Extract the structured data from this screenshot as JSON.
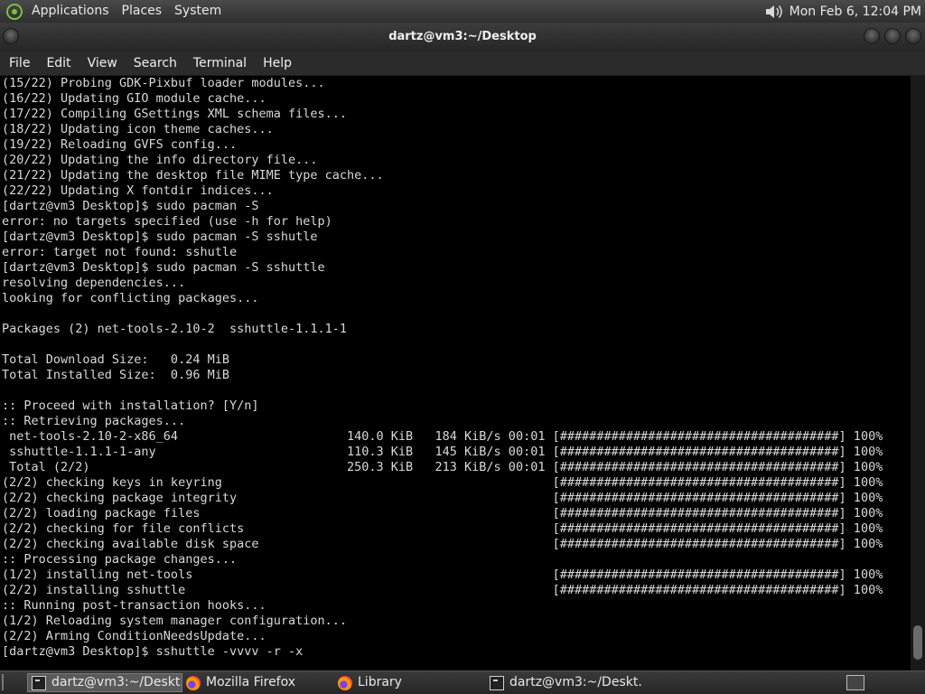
{
  "top_panel": {
    "menus": [
      "Applications",
      "Places",
      "System"
    ],
    "clock": "Mon Feb  6, 12:04 PM"
  },
  "window": {
    "title": "dartz@vm3:~/Desktop",
    "menus": [
      "File",
      "Edit",
      "View",
      "Search",
      "Terminal",
      "Help"
    ]
  },
  "terminal": {
    "lines": [
      "(15/22) Probing GDK-Pixbuf loader modules...",
      "(16/22) Updating GIO module cache...",
      "(17/22) Compiling GSettings XML schema files...",
      "(18/22) Updating icon theme caches...",
      "(19/22) Reloading GVFS config...",
      "(20/22) Updating the info directory file...",
      "(21/22) Updating the desktop file MIME type cache...",
      "(22/22) Updating X fontdir indices...",
      "[dartz@vm3 Desktop]$ sudo pacman -S",
      "error: no targets specified (use -h for help)",
      "[dartz@vm3 Desktop]$ sudo pacman -S sshutle",
      "error: target not found: sshutle",
      "[dartz@vm3 Desktop]$ sudo pacman -S sshuttle",
      "resolving dependencies...",
      "looking for conflicting packages...",
      "",
      "Packages (2) net-tools-2.10-2  sshuttle-1.1.1-1",
      "",
      "Total Download Size:   0.24 MiB",
      "Total Installed Size:  0.96 MiB",
      "",
      ":: Proceed with installation? [Y/n]",
      ":: Retrieving packages...",
      " net-tools-2.10-2-x86_64                       140.0 KiB   184 KiB/s 00:01 [######################################] 100%",
      " sshuttle-1.1.1-1-any                          110.3 KiB   145 KiB/s 00:01 [######################################] 100%",
      " Total (2/2)                                   250.3 KiB   213 KiB/s 00:01 [######################################] 100%",
      "(2/2) checking keys in keyring                                             [######################################] 100%",
      "(2/2) checking package integrity                                           [######################################] 100%",
      "(2/2) loading package files                                                [######################################] 100%",
      "(2/2) checking for file conflicts                                          [######################################] 100%",
      "(2/2) checking available disk space                                        [######################################] 100%",
      ":: Processing package changes...",
      "(1/2) installing net-tools                                                 [######################################] 100%",
      "(2/2) installing sshuttle                                                  [######################################] 100%",
      ":: Running post-transaction hooks...",
      "(1/2) Reloading system manager configuration...",
      "(2/2) Arming ConditionNeedsUpdate...",
      "[dartz@vm3 Desktop]$ sshuttle -vvvv -r -x"
    ]
  },
  "taskbar": {
    "tasks": [
      {
        "label": "dartz@vm3:~/Deskt...",
        "icon": "terminal-icon",
        "active": true
      },
      {
        "label": "Mozilla Firefox",
        "icon": "firefox-icon",
        "active": false
      },
      {
        "label": "Library",
        "icon": "firefox-icon",
        "active": false
      },
      {
        "label": "dartz@vm3:~/Deskt...",
        "icon": "terminal-icon",
        "active": false
      }
    ]
  }
}
